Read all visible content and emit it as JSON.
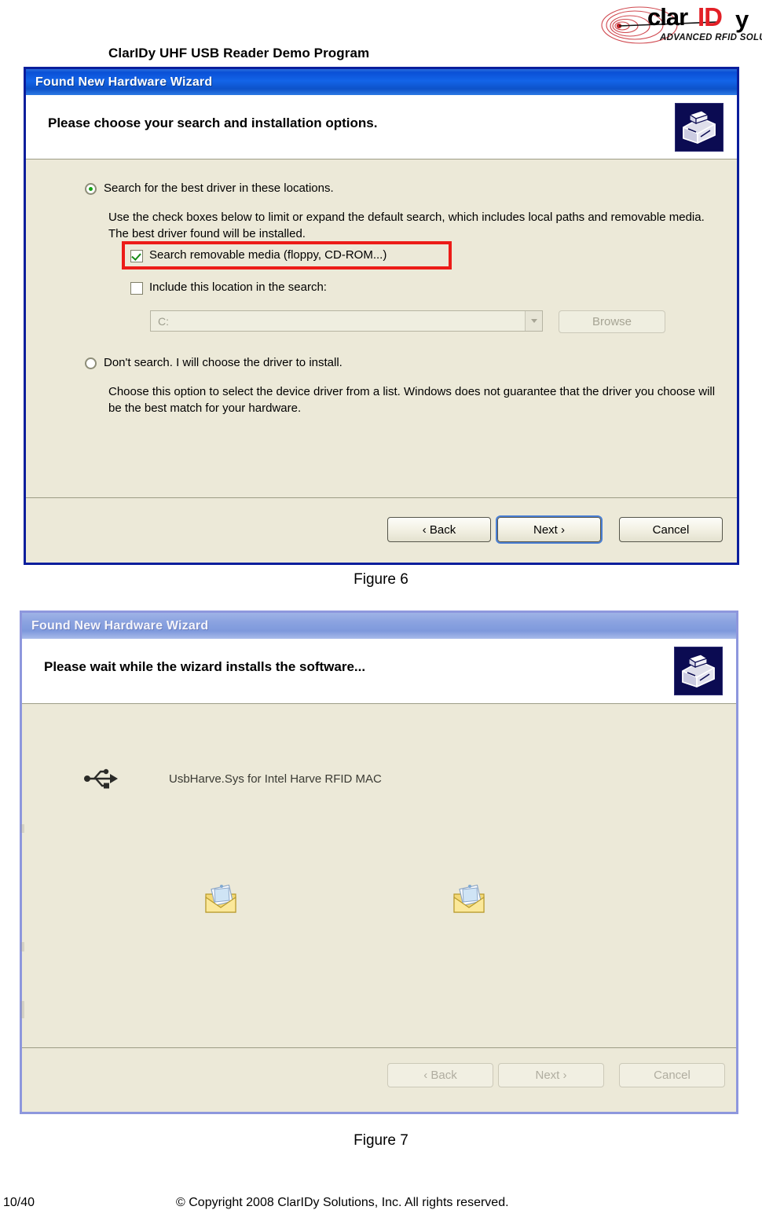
{
  "document": {
    "title": "ClarIDy UHF USB Reader Demo Program",
    "footer_page": "10/40",
    "footer_copyright": "© Copyright 2008 ClarIDy Solutions, Inc. All rights reserved."
  },
  "logo": {
    "text_part1": "clar",
    "text_part2": "ID",
    "text_part3": "y",
    "tagline": "ADVANCED RFID SOLUTIONS",
    "color_black": "#000000",
    "color_red": "#e21f26"
  },
  "figure6": {
    "caption": "Figure 6",
    "window_title": "Found New Hardware Wizard",
    "heading": "Please choose your search and installation options.",
    "option_search": {
      "label": "Search for the best driver in these locations.",
      "selected": true
    },
    "search_description": "Use the check boxes below to limit or expand the default search, which includes local paths and removable media. The best driver found will be installed.",
    "checkbox_removable": {
      "label": "Search removable media (floppy, CD-ROM...)",
      "checked": true,
      "highlight_color": "#ec1c18"
    },
    "checkbox_location": {
      "label": "Include this location in the search:",
      "checked": false
    },
    "location_combo": {
      "value": "C:",
      "enabled": false
    },
    "browse_button": {
      "label": "Browse",
      "enabled": false
    },
    "option_dont_search": {
      "label": "Don't search. I will choose the driver to install.",
      "selected": false
    },
    "dont_search_description": "Choose this option to select the device driver from a list.  Windows does not guarantee that the driver you choose will be the best match for your hardware.",
    "buttons": {
      "back": "‹ Back",
      "next": "Next ›",
      "cancel": "Cancel"
    }
  },
  "figure7": {
    "caption": "Figure 7",
    "window_title": "Found New Hardware Wizard",
    "heading": "Please wait while the wizard installs the software...",
    "driver_name": "UsbHarve.Sys for Intel Harve RFID MAC",
    "buttons": {
      "back": "‹ Back",
      "next": "Next ›",
      "cancel": "Cancel"
    }
  }
}
